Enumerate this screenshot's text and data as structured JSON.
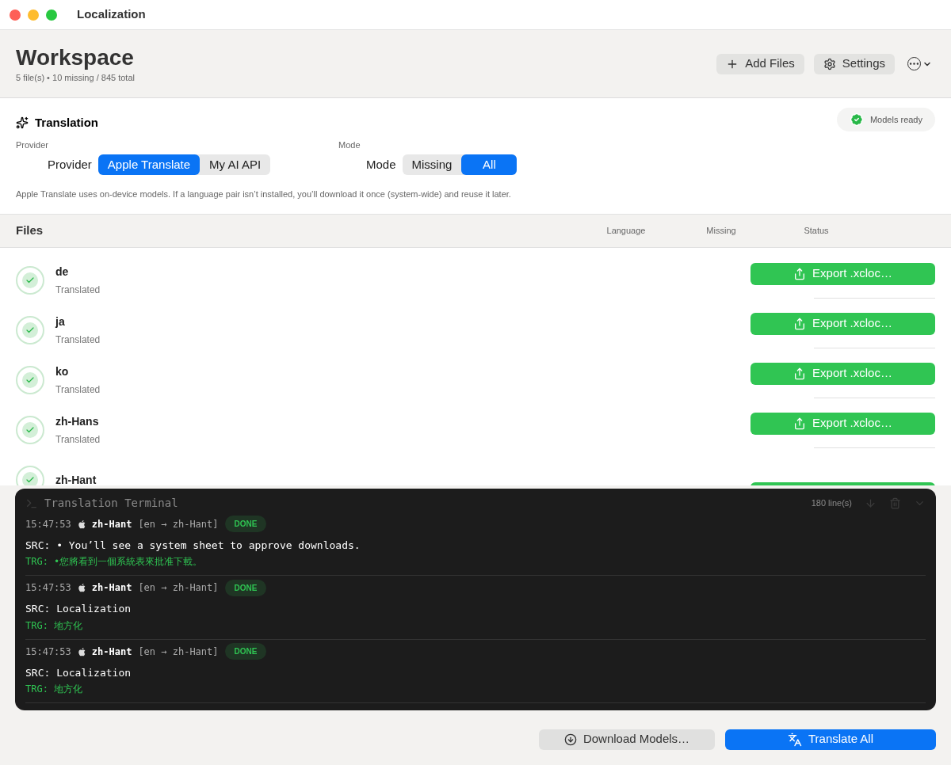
{
  "window": {
    "title": "Localization"
  },
  "header": {
    "title": "Workspace",
    "subtitle": "5 file(s) • 10 missing / 845 total",
    "buttons": [
      {
        "kind": "add",
        "label": "Add Files"
      },
      {
        "kind": "settings",
        "label": "Settings"
      },
      {
        "kind": "more"
      }
    ]
  },
  "translation": {
    "title": "Translation",
    "status": {
      "label": "Models ready",
      "ready": true
    },
    "provider": {
      "caption": "Provider",
      "label": "Provider",
      "options": [
        {
          "label": "Apple Translate",
          "selected": true
        },
        {
          "label": "My AI API",
          "selected": false
        }
      ]
    },
    "mode": {
      "caption": "Mode",
      "label": "Mode",
      "options": [
        {
          "label": "Missing",
          "selected": false
        },
        {
          "label": "All",
          "selected": true
        }
      ]
    },
    "note": "Apple Translate uses on-device models. If a language pair isn’t installed, you’ll download it once (system-wide) and reuse it later."
  },
  "files": {
    "title": "Files",
    "columns": [
      "Language",
      "Missing",
      "Status"
    ],
    "rows": [
      {
        "name": "de",
        "status": "Translated",
        "done": true,
        "action": "Export .xcloc…"
      },
      {
        "name": "ja",
        "status": "Translated",
        "done": true,
        "action": "Export .xcloc…"
      },
      {
        "name": "ko",
        "status": "Translated",
        "done": true,
        "action": "Export .xcloc…"
      },
      {
        "name": "zh-Hans",
        "status": "Translated",
        "done": true,
        "action": "Export .xcloc…"
      },
      {
        "name": "zh-Hant",
        "done": true
      }
    ]
  },
  "terminal": {
    "title": "Translation Terminal",
    "count": "180 line(s)",
    "entries": [
      {
        "time": "15:47:53",
        "lang": "zh-Hant",
        "pair": "[en → zh-Hant]",
        "badge": "DONE",
        "src": "SRC: • You’ll see a system sheet to approve downloads.",
        "trg": "TRG: •您將看到一個系統表來批准下載。"
      },
      {
        "time": "15:47:53",
        "lang": "zh-Hant",
        "pair": "[en → zh-Hant]",
        "badge": "DONE",
        "src": "SRC: Localization",
        "trg": "TRG: 地方化"
      },
      {
        "time": "15:47:53",
        "lang": "zh-Hant",
        "pair": "[en → zh-Hant]",
        "badge": "DONE",
        "src": "SRC: Localization",
        "trg": "TRG: 地方化"
      }
    ]
  },
  "footer": {
    "buttons": [
      {
        "kind": "download",
        "label": "Download Models…",
        "primary": false
      },
      {
        "kind": "translate",
        "label": "Translate All",
        "primary": true
      }
    ]
  }
}
